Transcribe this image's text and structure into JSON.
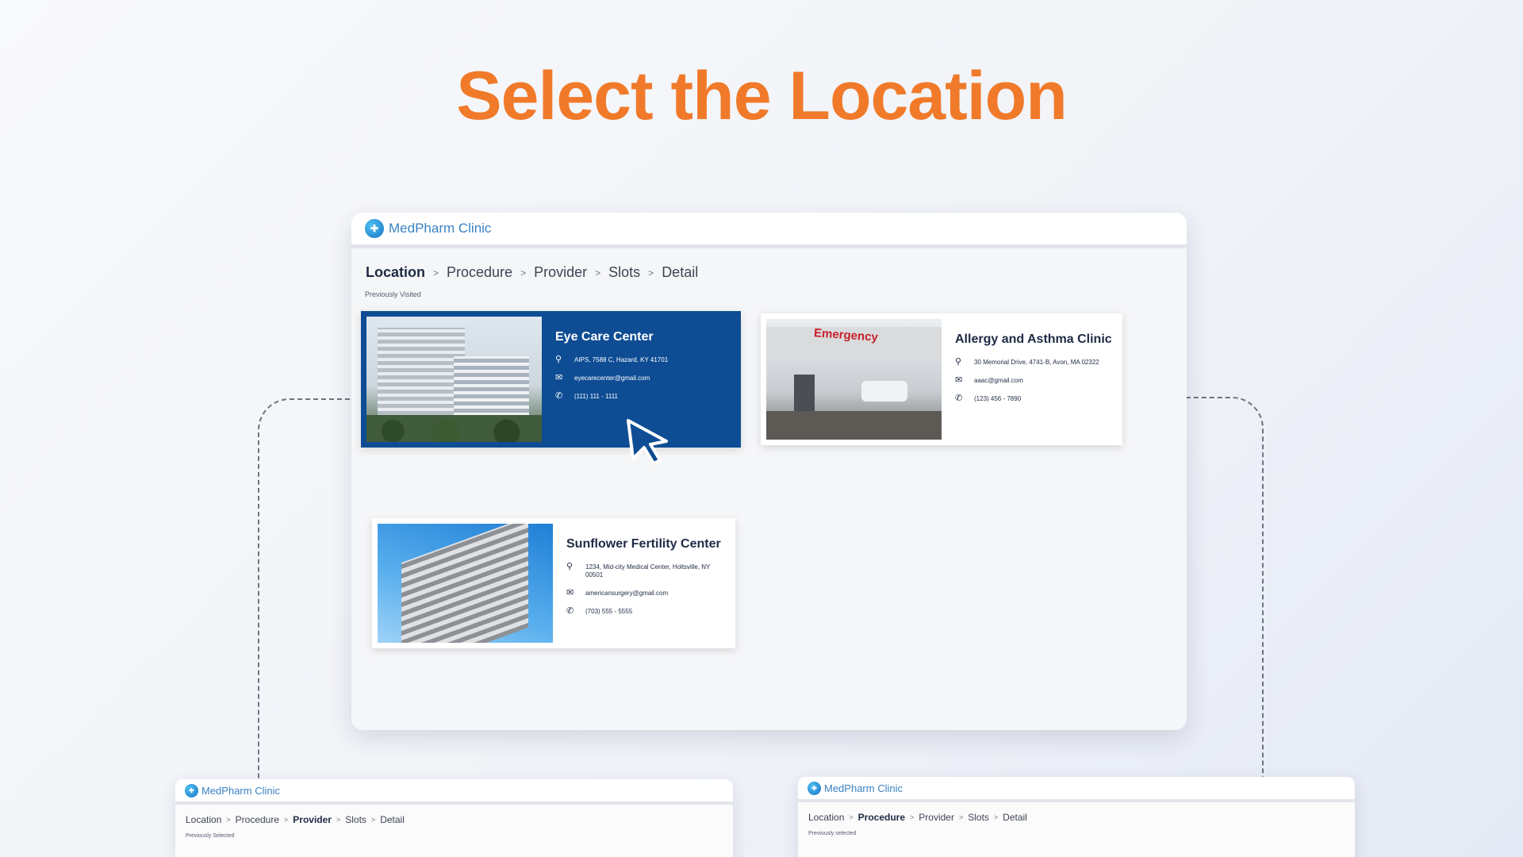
{
  "headline": "Select the Location",
  "colors": {
    "accent": "#f07a2a",
    "selected_card": "#0e4d94",
    "brand_blue": "#3a82c4"
  },
  "main_window": {
    "brand": "MedPharm Clinic",
    "breadcrumbs": [
      "Location",
      "Procedure",
      "Provider",
      "Slots",
      "Detail"
    ],
    "active_step": "Location",
    "section_label": "Previously Visited",
    "cards": [
      {
        "name": "Eye Care Center",
        "address": "AIPS, 7588 C, Hazard, KY 41701",
        "email": "eyecarecenter@gmail.com",
        "phone": "(111) 111 - 1111",
        "selected": true
      },
      {
        "name": "Allergy and Asthma Clinic",
        "address": "30 Memorial Drive, 4741-B, Avon, MA 02322",
        "email": "aaac@gmail.com",
        "phone": "(123) 456 - 7890",
        "photo_sign": "Emergency",
        "selected": false
      },
      {
        "name": "Sunflower Fertility Center",
        "address": "1234, Mid-city Medical Center, Holtsville, NY 00501",
        "email": "americansurgery@gmail.com",
        "phone": "(703) 555 - 5555",
        "selected": false
      }
    ]
  },
  "mini_left": {
    "brand": "MedPharm Clinic",
    "breadcrumbs": [
      "Location",
      "Procedure",
      "Provider",
      "Slots",
      "Detail"
    ],
    "active_step": "Provider",
    "section_label": "Previously Selected"
  },
  "mini_right": {
    "brand": "MedPharm Clinic",
    "breadcrumbs": [
      "Location",
      "Procedure",
      "Provider",
      "Slots",
      "Detail"
    ],
    "active_step": "Procedure",
    "section_label": "Previously selected"
  },
  "icons": {
    "address": "pin-icon",
    "email": "mail-icon",
    "phone": "phone-icon",
    "pointer": "cursor-pointer-icon"
  }
}
